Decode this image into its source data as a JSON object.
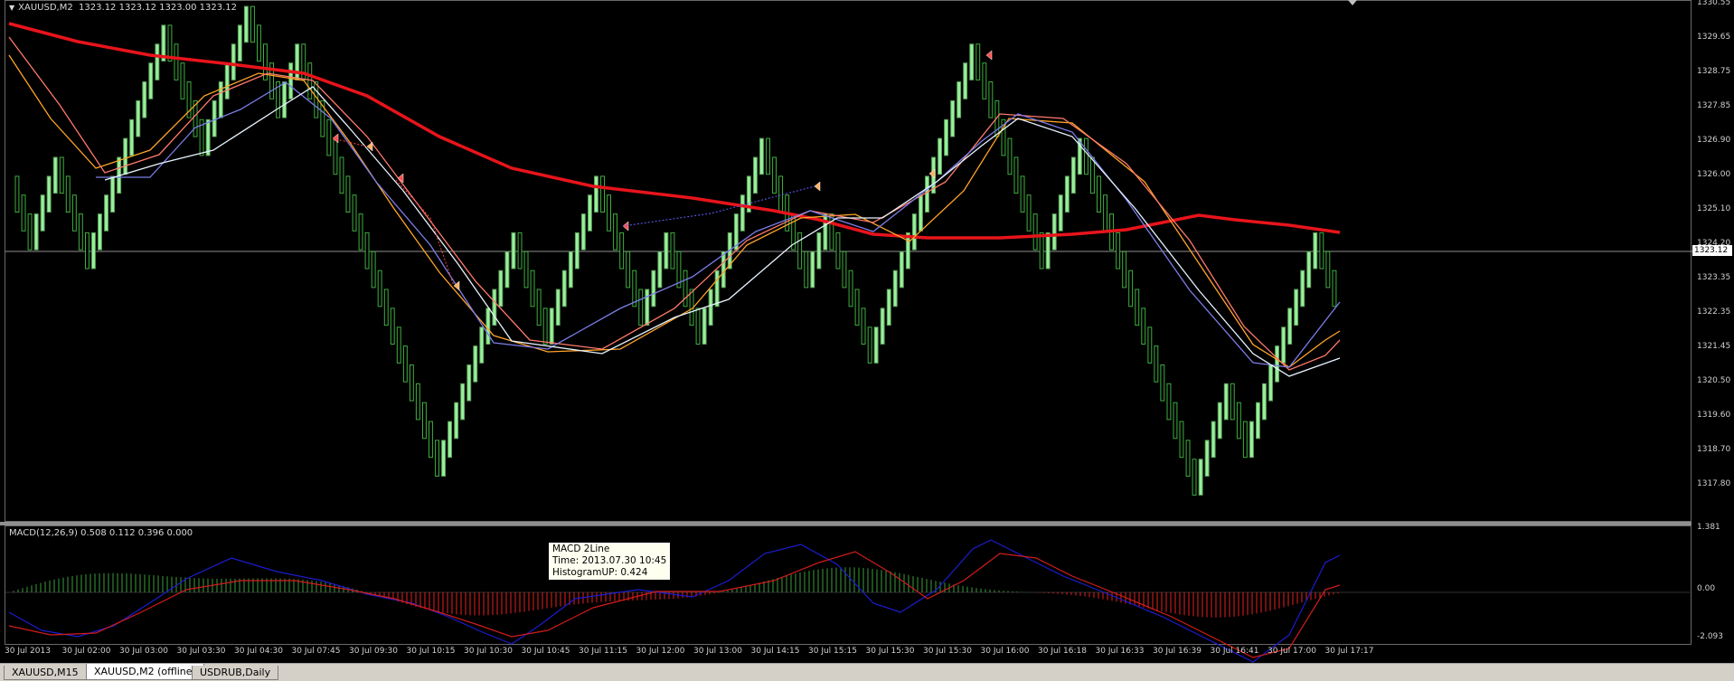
{
  "main_chart": {
    "title": "XAUUSD,M2  1323.12 1323.12 1323.00 1323.12",
    "price_ticks": [
      "1330.55",
      "1329.65",
      "1328.75",
      "1327.85",
      "1326.90",
      "1326.00",
      "1325.10",
      "1324.20",
      "1323.35",
      "1322.35",
      "1321.45",
      "1320.50",
      "1319.60",
      "1318.70",
      "1317.80"
    ],
    "current_price": "1323.12",
    "colors": {
      "up_brick": "#98f09a",
      "down_brick": "#000000",
      "brick_outline": "#3fae3f",
      "ma_slow": "#e8141b",
      "ma_orange": "#ffa428",
      "ma_salmon": "#ff7a6a",
      "ma_purple": "#7d7de8",
      "ma_white": "#e8f4ff"
    }
  },
  "macd": {
    "title": "MACD(12,26,9) 0.508 0.112 0.396 0.000",
    "axis_ticks": [
      "1.381",
      "0.00",
      "-2.093"
    ],
    "colors": {
      "hist_up": "#3c9b3c",
      "hist_down": "#e82020",
      "main_line": "#1c1ccf",
      "signal_line": "#d21c1c"
    }
  },
  "tooltip": {
    "line1": "MACD 2Line",
    "line2": "Time: 2013.07.30 10:45",
    "line3": "HistogramUP: 0.424"
  },
  "time_ticks": [
    "30 Jul 2013",
    "30 Jul 02:00",
    "30 Jul 03:00",
    "30 Jul 03:30",
    "30 Jul 04:30",
    "30 Jul 07:45",
    "30 Jul 09:30",
    "30 Jul 10:15",
    "30 Jul 10:30",
    "30 Jul 10:45",
    "30 Jul 11:15",
    "30 Jul 12:00",
    "30 Jul 13:00",
    "30 Jul 14:15",
    "30 Jul 15:15",
    "30 Jul 15:30",
    "30 Jul 15:30",
    "30 Jul 16:00",
    "30 Jul 16:18",
    "30 Jul 16:33",
    "30 Jul 16:39",
    "30 Jul 16:41",
    "30 Jul 17:00",
    "30 Jul 17:17"
  ],
  "tabs": [
    {
      "label": "XAUUSD,M15",
      "active": false
    },
    {
      "label": "XAUUSD,M2 (offline)",
      "active": true
    },
    {
      "label": "USDRUB,Daily",
      "active": false
    }
  ]
}
